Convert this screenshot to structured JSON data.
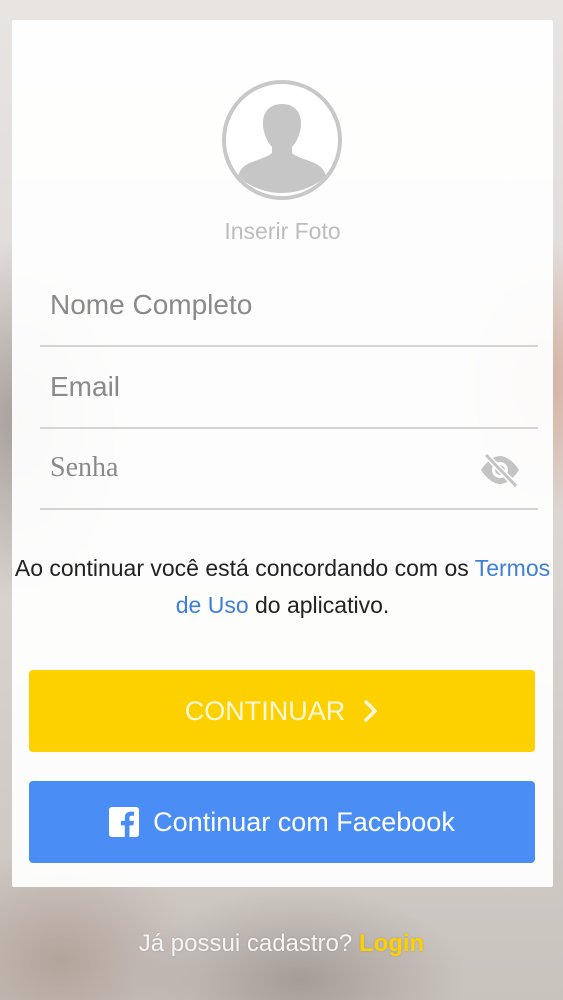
{
  "signup": {
    "avatar_icon": "user-silhouette-icon",
    "insert_photo_label": "Inserir Foto",
    "fields": {
      "name": {
        "placeholder": "Nome Completo",
        "value": ""
      },
      "email": {
        "placeholder": "Email",
        "value": ""
      },
      "password": {
        "placeholder": "Senha",
        "value": "",
        "toggle_icon": "eye-off-icon"
      }
    },
    "terms": {
      "prefix": "Ao continuar você está concordando com os ",
      "link": "Termos de Uso",
      "suffix": " do aplicativo."
    },
    "continue_label": "CONTINUAR",
    "continue_icon": "chevron-right-icon",
    "facebook_label": "Continuar com Facebook",
    "facebook_icon": "facebook-icon"
  },
  "footer": {
    "question": "Já possui cadastro? ",
    "login_link": "Login"
  },
  "colors": {
    "accent_yellow": "#fdd000",
    "facebook_blue": "#4a8ef5",
    "link_blue": "#3d7fd9"
  }
}
